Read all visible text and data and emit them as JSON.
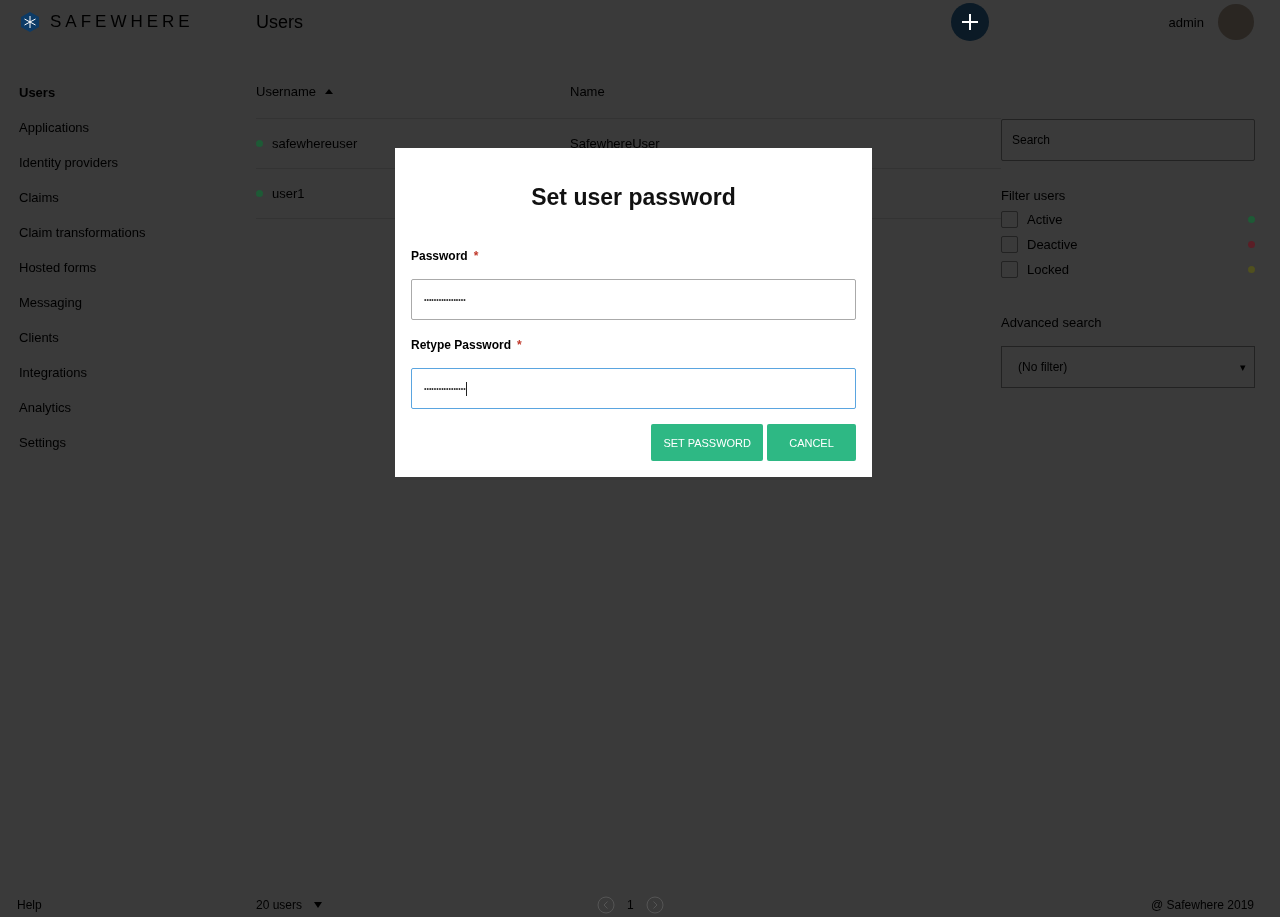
{
  "header": {
    "logo": "SAFEWHERE",
    "title": "Users",
    "user": "admin"
  },
  "sidebar": {
    "items": [
      {
        "label": "Users",
        "selected": true
      },
      {
        "label": "Applications",
        "selected": false
      },
      {
        "label": "Identity providers",
        "selected": false
      },
      {
        "label": "Claims",
        "selected": false
      },
      {
        "label": "Claim transformations",
        "selected": false
      },
      {
        "label": "Hosted forms",
        "selected": false
      },
      {
        "label": "Messaging",
        "selected": false
      },
      {
        "label": "Clients",
        "selected": false
      },
      {
        "label": "Integrations",
        "selected": false
      },
      {
        "label": "Analytics",
        "selected": false
      },
      {
        "label": "Settings",
        "selected": false
      }
    ],
    "help": "Help"
  },
  "table": {
    "columns": [
      {
        "label": "Username",
        "sorted_ascending": true
      },
      {
        "label": "Name"
      }
    ],
    "rows": [
      {
        "username": "safewhereuser",
        "name": "SafewhereUser",
        "color": "#1e5a36"
      },
      {
        "username": "user1",
        "color": "#1e5a36"
      }
    ]
  },
  "filters": {
    "search": {
      "placeholder": "Search"
    },
    "title": "Filter users",
    "items": [
      {
        "label": "Active",
        "checked": false,
        "color": "#1e5a36"
      },
      {
        "label": "Deactive",
        "checked": false,
        "color": "#5a1e26"
      },
      {
        "label": "Locked",
        "checked": false,
        "color": "#50501e"
      }
    ],
    "advanced_title": "Advanced search",
    "advanced_value": "(No filter)",
    "advanced_caret": "▾"
  },
  "footer": {
    "page_size": "20 users",
    "page": "1",
    "copyright": "@ Safewhere 2019"
  },
  "dialog": {
    "title": "Set user password",
    "fields": [
      {
        "label": "Password",
        "required_mark": "*",
        "value": "•••••••••••••••••",
        "focused": false
      },
      {
        "label": "Retype Password",
        "required_mark": "*",
        "value": "•••••••••••••••••",
        "focused": true
      }
    ],
    "buttons": [
      "SET PASSWORD",
      "CANCEL"
    ]
  }
}
